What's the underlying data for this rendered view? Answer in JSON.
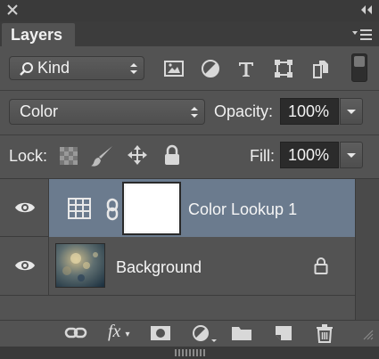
{
  "panel": {
    "tab_title": "Layers",
    "icons": {
      "close": "close-icon",
      "collapse": "double-chevron-icon",
      "menu": "panel-menu-icon"
    }
  },
  "filter": {
    "kind_label": "Kind",
    "icons": [
      "image-filter-icon",
      "adjustment-filter-icon",
      "type-filter-icon",
      "shape-filter-icon",
      "smart-object-filter-icon",
      "filter-toggle-icon"
    ]
  },
  "blend": {
    "mode": "Color",
    "opacity_label": "Opacity:",
    "opacity_value": "100%"
  },
  "lock": {
    "label": "Lock:",
    "icons": [
      "lock-transparent-pixels-icon",
      "lock-image-pixels-icon",
      "lock-position-icon",
      "lock-all-icon"
    ],
    "fill_label": "Fill:",
    "fill_value": "100%"
  },
  "layers": [
    {
      "name": "Color Lookup 1",
      "visible": true,
      "selected": true,
      "type": "adjustment"
    },
    {
      "name": "Background",
      "visible": true,
      "selected": false,
      "locked": true
    }
  ],
  "footer": {
    "icons": [
      "link-layers-icon",
      "fx-icon",
      "add-mask-icon",
      "new-adjustment-icon",
      "new-group-icon",
      "new-layer-icon",
      "delete-icon"
    ],
    "fx_text": "fx"
  },
  "colors": {
    "panel_bg": "#535353",
    "selected_row": "#6b7b8e",
    "field_bg": "#2b2b2b"
  }
}
